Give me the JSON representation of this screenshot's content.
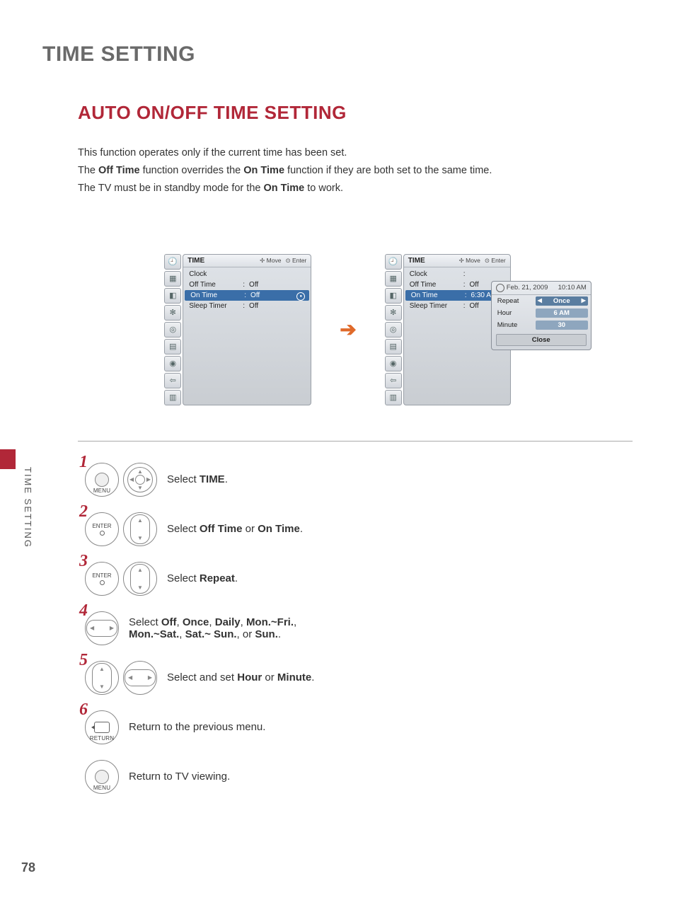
{
  "titles": {
    "main": "TIME SETTING",
    "sub": "AUTO ON/OFF TIME SETTING",
    "side_tab": "TIME SETTING"
  },
  "intro": {
    "p1": "This function operates only if the current time has been set.",
    "p2a": "The ",
    "p2b": "Off Time",
    "p2c": " function overrides the ",
    "p2d": "On Time",
    "p2e": " function if they are both set to the same time.",
    "p3a": "The TV must be in standby mode for the ",
    "p3b": "On Time",
    "p3c": " to work."
  },
  "osd": {
    "title": "TIME",
    "hint_move": "Move",
    "hint_enter": "Enter",
    "rows": {
      "clock": {
        "label": "Clock",
        "sep": "",
        "value": ""
      },
      "off_time": {
        "label": "Off Time",
        "sep": ":",
        "value": "Off"
      },
      "on_time": {
        "label": "On Time",
        "sep": ":",
        "value": "Off"
      },
      "sleep_timer": {
        "label": "Sleep Timer",
        "sep": ":",
        "value": "Off"
      }
    }
  },
  "osd2": {
    "rows": {
      "clock": {
        "label": "Clock",
        "sep": ":",
        "value": ""
      },
      "off_time": {
        "label": "Off Time",
        "sep": ":",
        "value": "Off"
      },
      "on_time": {
        "label": "On Time",
        "sep": ":",
        "value": "6:30 A"
      },
      "sleep_timer": {
        "label": "Sleep Timer",
        "sep": ":",
        "value": "Off"
      }
    }
  },
  "popup": {
    "date": "Feb. 21, 2009",
    "time": "10:10 AM",
    "rows": {
      "repeat": {
        "label": "Repeat",
        "value": "Once"
      },
      "hour": {
        "label": "Hour",
        "value": "6 AM"
      },
      "minute": {
        "label": "Minute",
        "value": "30"
      }
    },
    "close": "Close"
  },
  "buttons": {
    "menu": "MENU",
    "enter": "ENTER",
    "return": "RETURN"
  },
  "steps": {
    "s1a": "Select ",
    "s1b": "TIME",
    "s1c": ".",
    "s2a": "Select ",
    "s2b": "Off Time",
    "s2c": " or ",
    "s2d": "On Time",
    "s2e": ".",
    "s3a": "Select ",
    "s3b": "Repeat",
    "s3c": ".",
    "s4a": "Select ",
    "s4b": "Off",
    "s4c": ", ",
    "s4d": "Once",
    "s4e": ", ",
    "s4f": "Daily",
    "s4g": ", ",
    "s4h": "Mon.~Fri.",
    "s4i": ",",
    "s4j": "Mon.~Sat.",
    "s4k": ", ",
    "s4l": "Sat.~ Sun.",
    "s4m": ", or ",
    "s4n": "Sun.",
    "s4o": ".",
    "s5a": "Select and set ",
    "s5b": "Hour",
    "s5c": " or ",
    "s5d": "Minute",
    "s5e": ".",
    "s6": "Return to the previous menu.",
    "s7": "Return to TV viewing."
  },
  "step_numbers": {
    "n1": "1",
    "n2": "2",
    "n3": "3",
    "n4": "4",
    "n5": "5",
    "n6": "6"
  },
  "page_number": "78"
}
